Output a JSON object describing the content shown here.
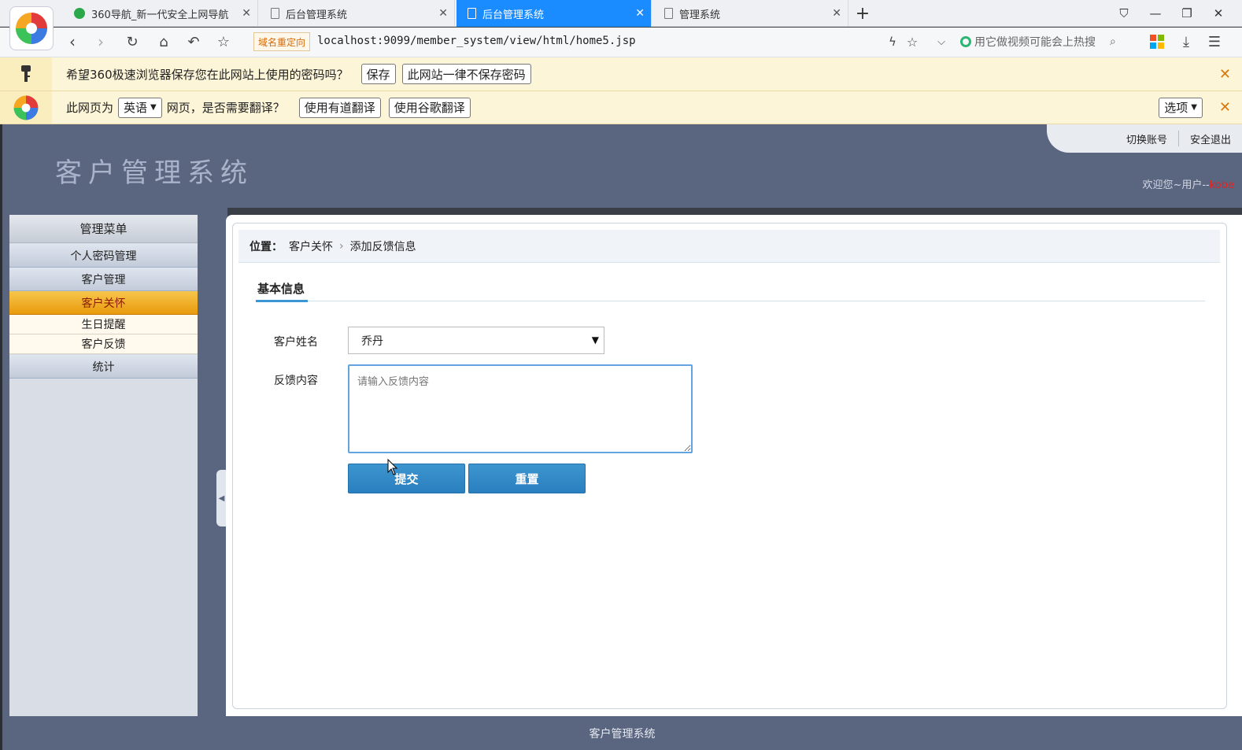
{
  "browser": {
    "tabs": [
      {
        "title": "360导航_新一代安全上网导航",
        "active": false
      },
      {
        "title": "后台管理系统",
        "active": false
      },
      {
        "title": "后台管理系统",
        "active": true
      },
      {
        "title": "管理系统",
        "active": false
      }
    ],
    "redirect_badge": "域名重定向",
    "url": "localhost:9099/member_system/view/html/home5.jsp",
    "search_placeholder": "用它做视频可能会上热搜",
    "password_bar": {
      "text": "希望360极速浏览器保存您在此网站上使用的密码吗？",
      "save_label": "保存",
      "never_label": "此网站一律不保存密码"
    },
    "translate_bar": {
      "prefix": "此网页为",
      "language": "英语",
      "suffix": "网页，是否需要翻译？",
      "youdao_label": "使用有道翻译",
      "google_label": "使用谷歌翻译",
      "options_label": "选项"
    }
  },
  "app": {
    "title": "客户管理系统",
    "top_links": {
      "switch": "切换账号",
      "logout": "安全退出"
    },
    "welcome_prefix": "欢迎您~用户--",
    "username": "kobe",
    "menu": {
      "header": "管理菜单",
      "items": [
        "个人密码管理",
        "客户管理",
        "客户关怀"
      ],
      "subitems": [
        "生日提醒",
        "客户反馈"
      ],
      "last_item": "统计"
    },
    "breadcrumb": {
      "label": "位置：",
      "parent": "客户关怀",
      "current": "添加反馈信息"
    },
    "tab_label": "基本信息",
    "form": {
      "name_label": "客户姓名",
      "name_value": "乔丹",
      "feedback_label": "反馈内容",
      "feedback_placeholder": "请输入反馈内容",
      "submit_label": "提交",
      "reset_label": "重置"
    },
    "footer": "客户管理系统"
  },
  "colors": {
    "accent": "#1a8cff",
    "header": "#5a6580",
    "menu_active": "#f0b030",
    "button": "#2f87c6"
  }
}
